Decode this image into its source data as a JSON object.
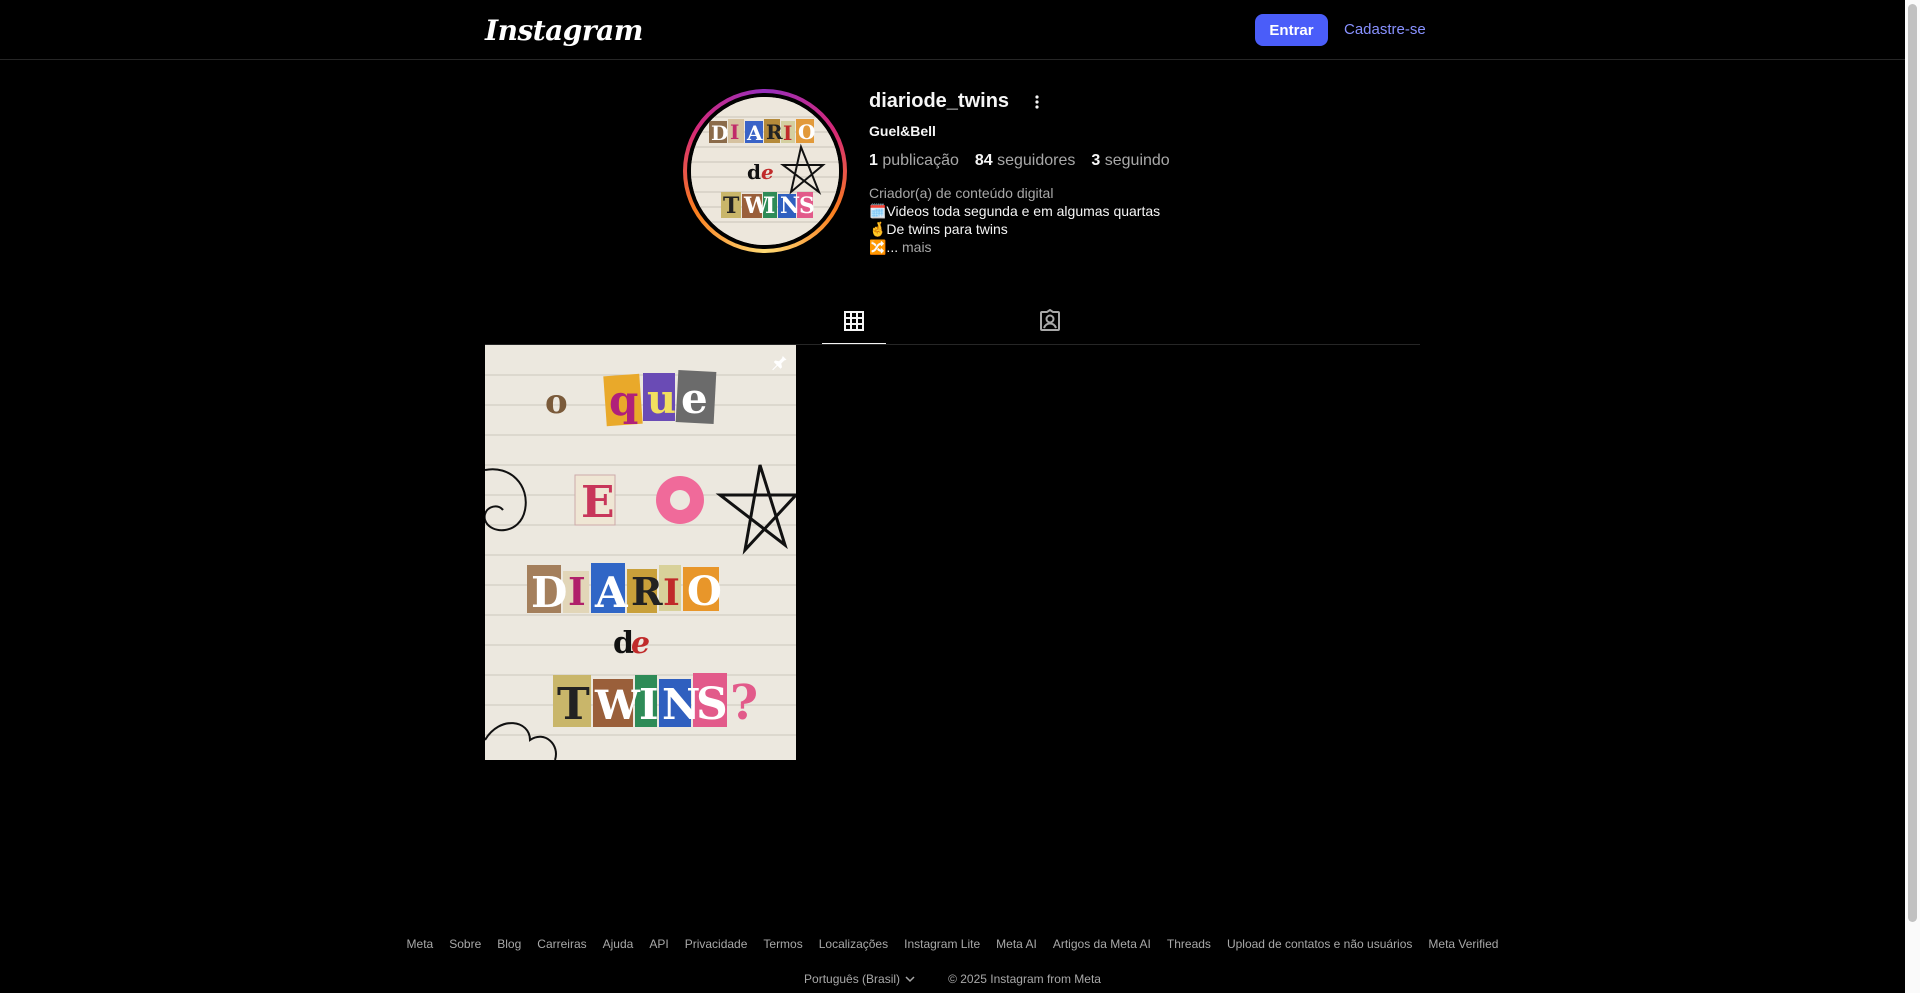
{
  "header": {
    "logo_text": "Instagram",
    "login_label": "Entrar",
    "signup_label": "Cadastre-se",
    "accent_color": "#4a5df9"
  },
  "profile": {
    "username": "diariode_twins",
    "full_name": "Guel&Bell",
    "stats": {
      "posts_count": "1",
      "posts_label": "publicação",
      "followers_count": "84",
      "followers_label": "seguidores",
      "following_count": "3",
      "following_label": "seguindo"
    },
    "category": "Criador(a) de conteúdo digital",
    "bio_line1": "🗓️Videos toda segunda e em algumas quartas",
    "bio_line2": "🤞De twins para twins",
    "bio_line3_prefix": "🔀...",
    "bio_more_label": "mais",
    "avatar_text": [
      "DIARIO",
      "de",
      "TWINS"
    ]
  },
  "tabs": [
    {
      "icon": "grid-icon",
      "active": true
    },
    {
      "icon": "tagged-icon",
      "active": false
    }
  ],
  "post": {
    "pinned": true,
    "text_lines": [
      "o que",
      "E o",
      "DIARIO",
      "de",
      "TWINS?"
    ]
  },
  "footer": {
    "links": [
      "Meta",
      "Sobre",
      "Blog",
      "Carreiras",
      "Ajuda",
      "API",
      "Privacidade",
      "Termos",
      "Localizações",
      "Instagram Lite",
      "Meta AI",
      "Artigos da Meta AI",
      "Threads",
      "Upload de contatos e não usuários",
      "Meta Verified"
    ],
    "language": "Português (Brasil)",
    "copyright": "© 2025 Instagram from Meta"
  }
}
